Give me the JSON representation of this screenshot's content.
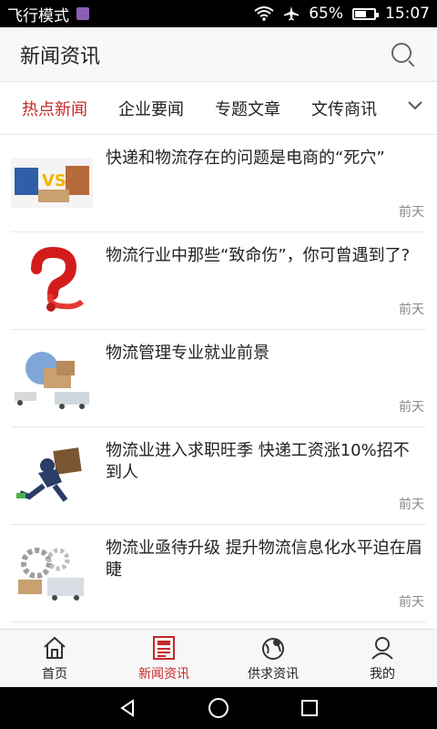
{
  "statusbar": {
    "mode": "飞行模式",
    "battery": "65%",
    "battery_level": 0.65,
    "time": "15:07",
    "icons": [
      "flight-mode-icon",
      "wifi-icon",
      "airplane-icon",
      "battery-icon"
    ]
  },
  "header": {
    "title": "新闻资讯",
    "search_icon": "search-icon"
  },
  "tabs": [
    {
      "label": "热点新闻",
      "active": true
    },
    {
      "label": "企业要闻",
      "active": false
    },
    {
      "label": "专题文章",
      "active": false
    },
    {
      "label": "文传商讯",
      "active": false
    }
  ],
  "list": [
    {
      "title": "快递和物流存在的问题是电商的“死穴”",
      "time": "前天",
      "thumb": "vs-parcels-image"
    },
    {
      "title": "物流行业中那些“致命伤”，你可曾遇到了?",
      "time": "前天",
      "thumb": "red-question-mark-image"
    },
    {
      "title": "物流管理专业就业前景",
      "time": "前天",
      "thumb": "globe-boxes-trucks-image"
    },
    {
      "title": "物流业进入求职旺季 快递工资涨10%招不到人",
      "time": "前天",
      "thumb": "courier-running-image"
    },
    {
      "title": "物流业亟待升级 提升物流信息化水平迫在眉睫",
      "time": "前天",
      "thumb": "gears-truck-image"
    }
  ],
  "tabbar": [
    {
      "label": "首页",
      "icon": "home-icon",
      "active": false
    },
    {
      "label": "新闻资讯",
      "icon": "newspaper-icon",
      "active": true
    },
    {
      "label": "供求资讯",
      "icon": "globe-pin-icon",
      "active": false
    },
    {
      "label": "我的",
      "icon": "user-icon",
      "active": false
    }
  ],
  "colors": {
    "accent": "#c62828",
    "header_bg": "#f8f8f8"
  }
}
